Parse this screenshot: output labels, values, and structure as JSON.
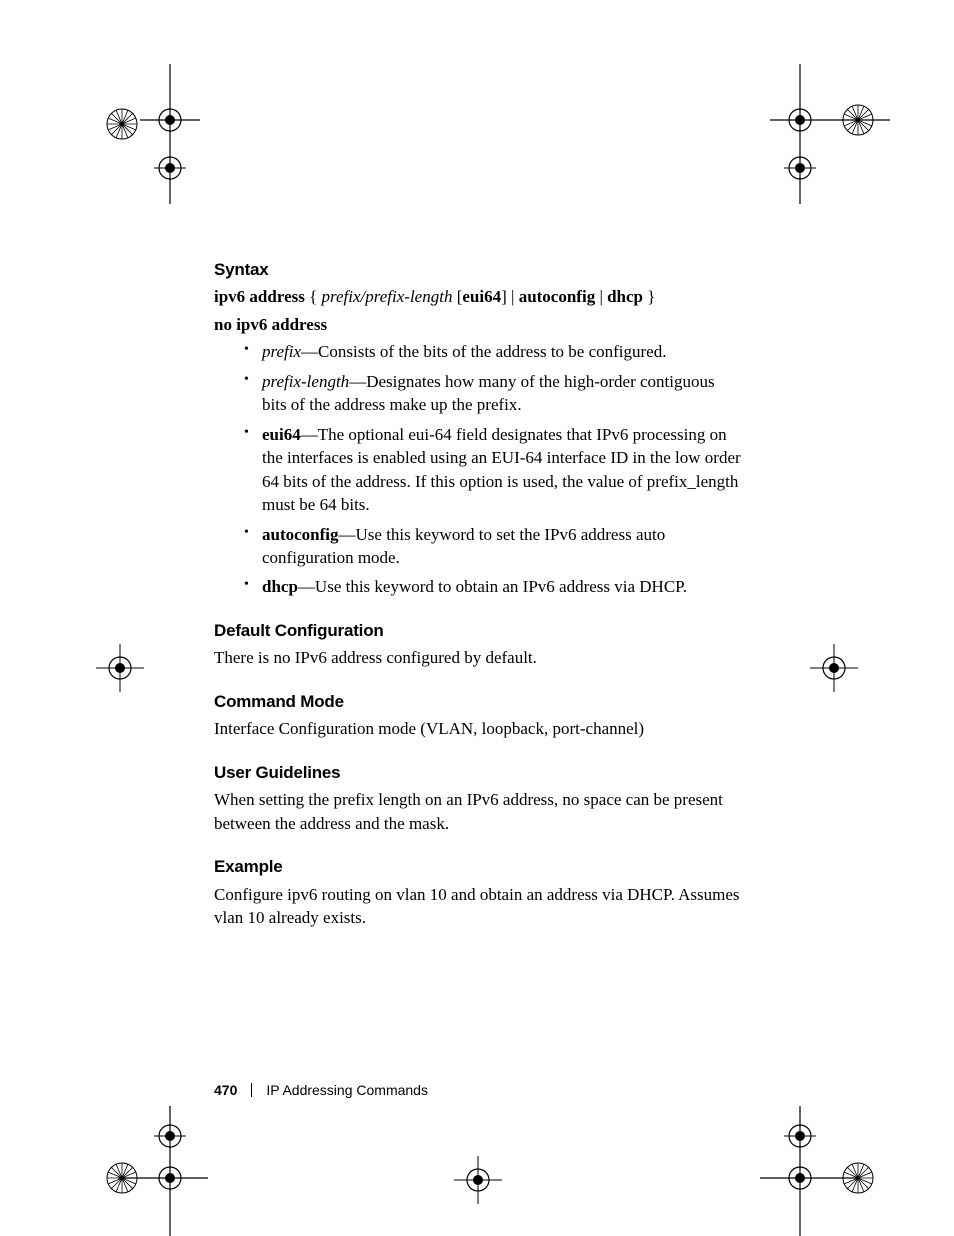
{
  "sections": {
    "syntax": {
      "heading": "Syntax",
      "cmd_prefix": "ipv6 address",
      "cmd_brace_open": " { ",
      "cmd_arg_italic": "prefix/prefix-length",
      "cmd_bracket_open": " [",
      "cmd_eui": "eui64",
      "cmd_bracket_close": "] | ",
      "cmd_autoconfig": "autoconfig",
      "cmd_pipe": " | ",
      "cmd_dhcp": "dhcp",
      "cmd_brace_close": " }",
      "no_cmd": "no ipv6 address",
      "params": [
        {
          "term": "prefix",
          "italic": true,
          "desc": "—Consists of the bits of the address to be configured."
        },
        {
          "term": "prefix-length",
          "italic": true,
          "desc": "—Designates how many of the high-order contiguous bits of the address make up the prefix."
        },
        {
          "term": "eui64",
          "italic": false,
          "desc": "—The optional eui-64 field designates that IPv6 processing on the interfaces is enabled using an EUI-64 interface ID in the low order 64 bits of the address. If this option is used, the value of prefix_length must be 64 bits."
        },
        {
          "term": "autoconfig",
          "italic": false,
          "desc": "—Use this keyword to set the IPv6 address auto configuration mode."
        },
        {
          "term": "dhcp",
          "italic": false,
          "desc": "—Use this keyword to obtain an IPv6 address via DHCP."
        }
      ]
    },
    "default_config": {
      "heading": "Default Configuration",
      "body": "There is no IPv6 address configured by default."
    },
    "command_mode": {
      "heading": "Command Mode",
      "body": "Interface Configuration mode (VLAN, loopback, port-channel)"
    },
    "user_guidelines": {
      "heading": "User Guidelines",
      "body": "When setting the prefix length on an IPv6 address, no space can be present between the address and the mask."
    },
    "example": {
      "heading": "Example",
      "body": "Configure ipv6 routing on vlan 10 and obtain an address via DHCP. Assumes vlan 10 already exists."
    }
  },
  "footer": {
    "page_number": "470",
    "chapter": "IP Addressing Commands"
  }
}
